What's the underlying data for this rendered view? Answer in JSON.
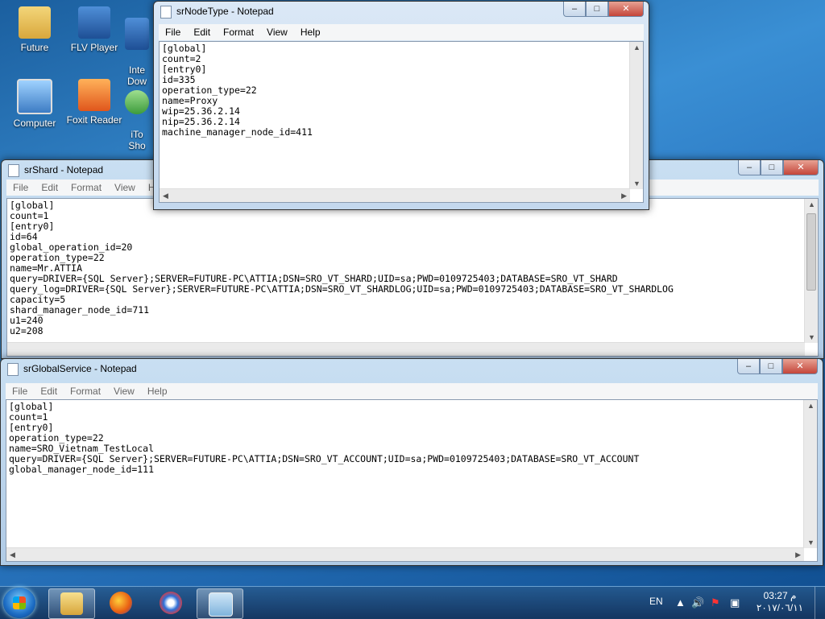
{
  "desktop": {
    "icons": [
      {
        "label": "Future",
        "icon": "folder-icon"
      },
      {
        "label": "FLV Player",
        "icon": "flv-player-icon"
      },
      {
        "label": "Inte\nDow",
        "icon": "internet-download-icon"
      },
      {
        "label": "Computer",
        "icon": "computer-icon"
      },
      {
        "label": "Foxit Reader",
        "icon": "foxit-reader-icon"
      },
      {
        "label": "iTo\nSho",
        "icon": "shortcut-icon"
      }
    ]
  },
  "menu": {
    "file": "File",
    "edit": "Edit",
    "format": "Format",
    "view": "View",
    "help": "Help"
  },
  "windows": {
    "nodetype": {
      "title": "srNodeType - Notepad",
      "content": "[global]\ncount=2\n[entry0]\nid=335\noperation_type=22\nname=Proxy\nwip=25.36.2.14\nnip=25.36.2.14\nmachine_manager_node_id=411"
    },
    "shard": {
      "title": "srShard - Notepad",
      "content": "[global]\ncount=1\n[entry0]\nid=64\nglobal_operation_id=20\noperation_type=22\nname=Mr.ATTIA\nquery=DRIVER={SQL Server};SERVER=FUTURE-PC\\ATTIA;DSN=SRO_VT_SHARD;UID=sa;PWD=0109725403;DATABASE=SRO_VT_SHARD\nquery_log=DRIVER={SQL Server};SERVER=FUTURE-PC\\ATTIA;DSN=SRO_VT_SHARDLOG;UID=sa;PWD=0109725403;DATABASE=SRO_VT_SHARDLOG\ncapacity=5\nshard_manager_node_id=711\nu1=240\nu2=208"
    },
    "global": {
      "title": "srGlobalService - Notepad",
      "content": "[global]\ncount=1\n[entry0]\noperation_type=22\nname=SRO_Vietnam_TestLocal\nquery=DRIVER={SQL Server};SERVER=FUTURE-PC\\ATTIA;DSN=SRO_VT_ACCOUNT;UID=sa;PWD=0109725403;DATABASE=SRO_VT_ACCOUNT\nglobal_manager_node_id=111"
    }
  },
  "taskbar": {
    "apps": [
      "explorer-icon",
      "firefox-icon",
      "app-icon",
      "notepad-icon"
    ],
    "language": "EN",
    "time": "03:27 م",
    "date": "٢٠١٧/٠٦/١١"
  }
}
